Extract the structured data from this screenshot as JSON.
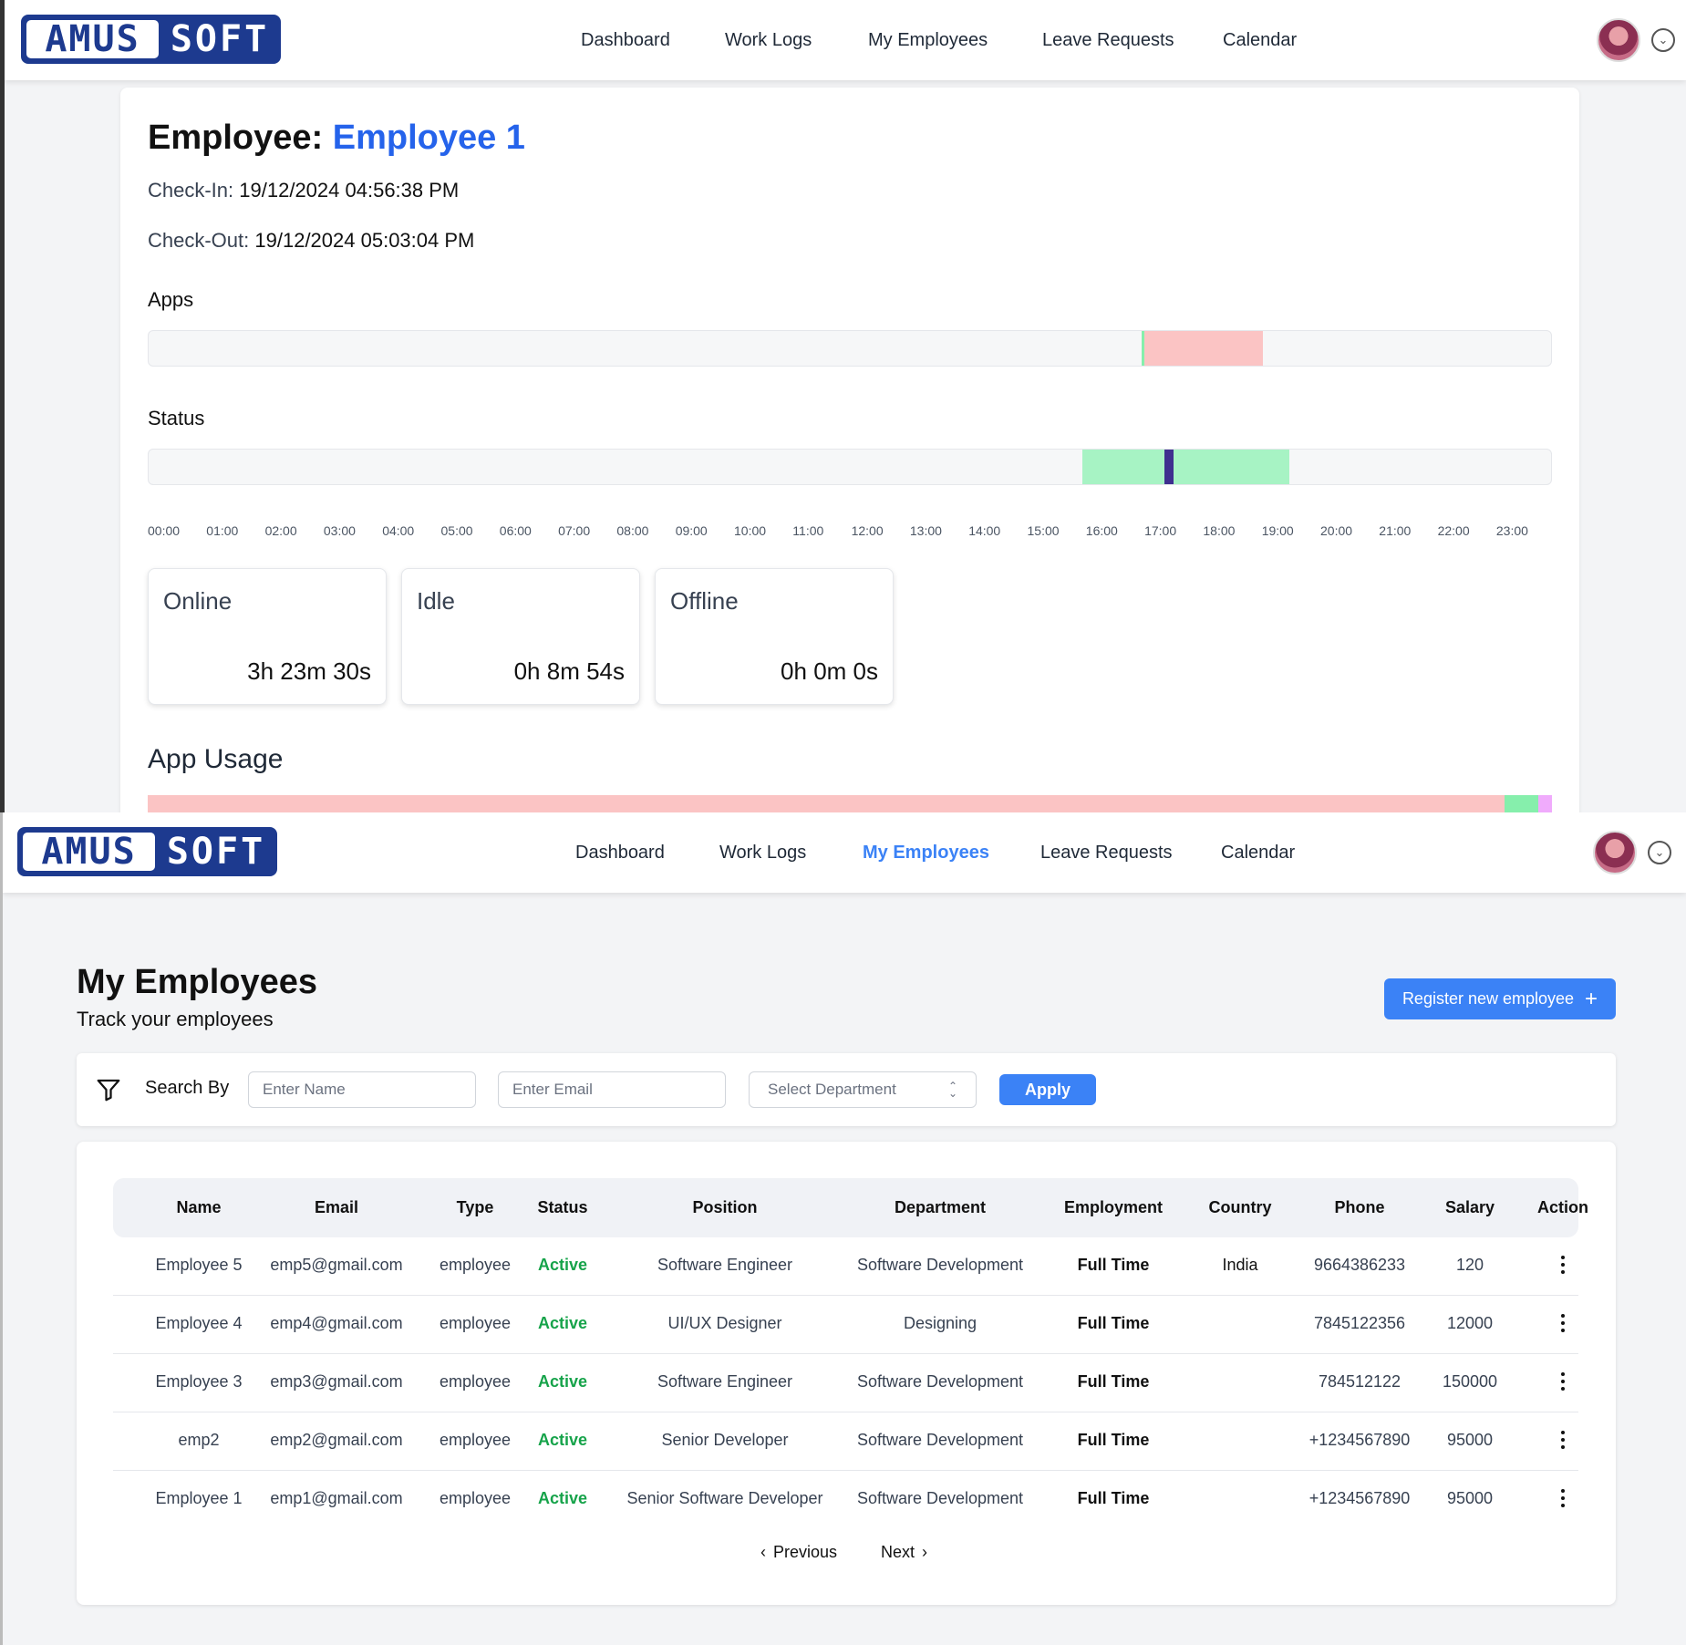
{
  "brand": {
    "logo_left": "AMUS",
    "logo_right": "SOFT"
  },
  "nav": {
    "dashboard": "Dashboard",
    "work_logs": "Work Logs",
    "my_employees": "My Employees",
    "leave_requests": "Leave Requests",
    "calendar": "Calendar"
  },
  "worklog": {
    "title_prefix": "Employee:",
    "employee_name": "Employee 1",
    "checkin_label": "Check-In:",
    "checkin_value": "19/12/2024 04:56:38 PM",
    "checkout_label": "Check-Out:",
    "checkout_value": "19/12/2024 05:03:04 PM",
    "apps_label": "Apps",
    "status_label": "Status",
    "hours": [
      "00:00",
      "01:00",
      "02:00",
      "03:00",
      "04:00",
      "05:00",
      "06:00",
      "07:00",
      "08:00",
      "09:00",
      "10:00",
      "11:00",
      "12:00",
      "13:00",
      "14:00",
      "15:00",
      "16:00",
      "17:00",
      "18:00",
      "19:00",
      "20:00",
      "21:00",
      "22:00",
      "23:00"
    ],
    "apps_segments": [
      {
        "start_hour": 16.94,
        "end_hour": 16.98,
        "color": "#86efac"
      },
      {
        "start_hour": 16.98,
        "end_hour": 19.0,
        "color": "#fbc4c4"
      }
    ],
    "status_segments": [
      {
        "start_hour": 15.92,
        "end_hour": 17.32,
        "color": "#a7f3c4"
      },
      {
        "start_hour": 17.32,
        "end_hour": 17.48,
        "color": "#3f2f8f"
      },
      {
        "start_hour": 17.48,
        "end_hour": 19.45,
        "color": "#a7f3c4"
      }
    ],
    "stats": [
      {
        "label": "Online",
        "value": "3h 23m 30s"
      },
      {
        "label": "Idle",
        "value": "0h 8m 54s"
      },
      {
        "label": "Offline",
        "value": "0h 0m 0s"
      }
    ],
    "app_usage_title": "App Usage",
    "app_usage_shares": [
      {
        "share": 0.966,
        "color": "#fbc4c4"
      },
      {
        "share": 0.024,
        "color": "#86efac"
      },
      {
        "share": 0.01,
        "color": "#f0abfc"
      }
    ]
  },
  "employees_page": {
    "title": "My Employees",
    "subtitle": "Track your employees",
    "register_button": "Register new employee",
    "filter": {
      "search_by": "Search By",
      "name_placeholder": "Enter Name",
      "email_placeholder": "Enter Email",
      "department_placeholder": "Select Department",
      "apply": "Apply"
    },
    "columns": [
      "Name",
      "Email",
      "Type",
      "Status",
      "Position",
      "Department",
      "Employment",
      "Country",
      "Phone",
      "Salary",
      "Action"
    ],
    "rows": [
      {
        "name": "Employee 5",
        "email": "emp5@gmail.com",
        "type": "employee",
        "status": "Active",
        "position": "Software Engineer",
        "department": "Software Development",
        "employment": "Full Time",
        "country": "India",
        "phone": "9664386233",
        "salary": "120"
      },
      {
        "name": "Employee 4",
        "email": "emp4@gmail.com",
        "type": "employee",
        "status": "Active",
        "position": "UI/UX Designer",
        "department": "Designing",
        "employment": "Full Time",
        "country": "",
        "phone": "7845122356",
        "salary": "12000"
      },
      {
        "name": "Employee 3",
        "email": "emp3@gmail.com",
        "type": "employee",
        "status": "Active",
        "position": "Software Engineer",
        "department": "Software Development",
        "employment": "Full Time",
        "country": "",
        "phone": "784512122",
        "salary": "150000"
      },
      {
        "name": "emp2",
        "email": "emp2@gmail.com",
        "type": "employee",
        "status": "Active",
        "position": "Senior Developer",
        "department": "Software Development",
        "employment": "Full Time",
        "country": "",
        "phone": "+1234567890",
        "salary": "95000"
      },
      {
        "name": "Employee 1",
        "email": "emp1@gmail.com",
        "type": "employee",
        "status": "Active",
        "position": "Senior Software Developer",
        "department": "Software Development",
        "employment": "Full Time",
        "country": "",
        "phone": "+1234567890",
        "salary": "95000"
      }
    ],
    "pagination": {
      "previous": "Previous",
      "next": "Next"
    }
  },
  "colors": {
    "accent": "#3b82f6",
    "brand": "#1d3a8f",
    "active_status": "#16a34a"
  }
}
